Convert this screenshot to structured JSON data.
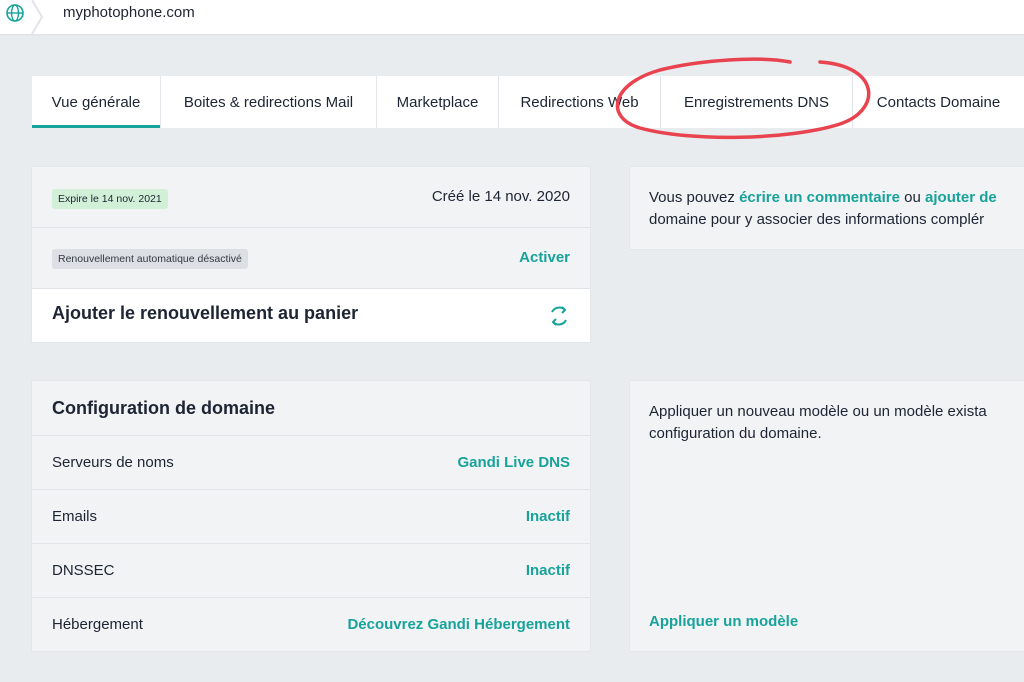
{
  "topbar": {
    "domain": "myphotophone.com",
    "globe_icon": "globe-icon"
  },
  "tabs": [
    {
      "label": "Vue générale",
      "active": true
    },
    {
      "label": "Boites & redirections Mail",
      "active": false
    },
    {
      "label": "Marketplace",
      "active": false
    },
    {
      "label": "Redirections Web",
      "active": false
    },
    {
      "label": "Enregistrements DNS",
      "active": false,
      "highlighted": true
    },
    {
      "label": "Contacts Domaine",
      "active": false
    }
  ],
  "renewal_card": {
    "expiry_badge": "Expire le 14 nov. 2021",
    "created": "Créé le 14 nov. 2020",
    "auto_renew_badge": "Renouvellement automatique désactivé",
    "activate_link": "Activer",
    "add_renewal": "Ajouter le renouvellement au panier",
    "refresh_icon": "refresh-icon"
  },
  "comment_card": {
    "text_before": "Vous pouvez ",
    "link1": "écrire un commentaire",
    "text_mid": " ou ",
    "link2": "ajouter de",
    "line2": "domaine pour y associer des informations complér"
  },
  "config_card": {
    "title": "Configuration de domaine",
    "rows": [
      {
        "label": "Serveurs de noms",
        "value": "Gandi Live DNS"
      },
      {
        "label": "Emails",
        "value": "Inactif"
      },
      {
        "label": "DNSSEC",
        "value": "Inactif"
      },
      {
        "label": "Hébergement",
        "value": "Découvrez Gandi Hébergement"
      }
    ]
  },
  "template_card": {
    "line1": "Appliquer un nouveau modèle ou un modèle exista",
    "line2": "configuration du domaine.",
    "apply_link": "Appliquer un modèle"
  },
  "colors": {
    "accent": "#18a39a",
    "annotation": "#e8434f",
    "background": "#e8ecef"
  }
}
